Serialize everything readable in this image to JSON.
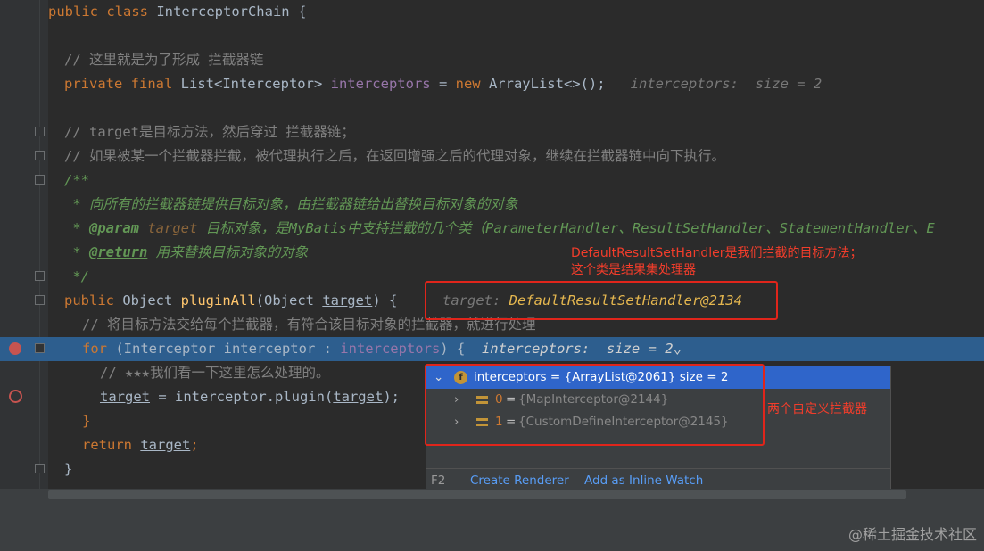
{
  "code": {
    "l1_kw": "public class ",
    "l1_rest": "InterceptorChain {",
    "l3_comment": "// 这里就是为了形成 拦截器链",
    "l4_kw": "private final ",
    "l4_type": "List<Interceptor> ",
    "l4_field": "interceptors",
    "l4_eq": " = ",
    "l4_new": "new ",
    "l4_rest": "ArrayList<>();",
    "l4_inlay": "interceptors:  size = 2",
    "l6_comment": "// target是目标方法，然后穿过 拦截器链；",
    "l7_comment": "// 如果被某一个拦截器拦截，被代理执行之后，在返回增强之后的代理对象，继续在拦截器链中向下执行。",
    "l8_doc": "/**",
    "l9_doc": " * 向所有的拦截器链提供目标对象，由拦截器链给出替换目标对象的对象",
    "l10_star": " * ",
    "l10_tag": "@param",
    "l10_name": " target",
    "l10_text": " 目标对象，是MyBatis中支持拦截的几个类（ParameterHandler、ResultSetHandler、StatementHandler、E",
    "l11_star": " * ",
    "l11_tag": "@return",
    "l11_text": " 用来替换目标对象的对象",
    "l12_doc": " */",
    "l13_kw": "public ",
    "l13_type": "Object ",
    "l13_fn": "pluginAll",
    "l13_paren": "(Object ",
    "l13_param": "target",
    "l13_end": ") {",
    "l13_inlay_label": "target:",
    "l13_inlay_value": "DefaultResultSetHandler@2134",
    "l14_comment": "// 将目标方法交给每个拦截器，有符合该目标对象的拦截器，就进行处理",
    "l15_kw": "for ",
    "l15_paren": "(Interceptor interceptor : ",
    "l15_field": "interceptors",
    "l15_end": ") {",
    "l15_inlay": "interceptors:  size = 2",
    "l16_comment": "// ★★★我们看一下这里怎么处理的。",
    "l17_param": "target",
    "l17_mid": " = interceptor.plugin(",
    "l17_param2": "target",
    "l17_end": ");",
    "l18_brace": "}",
    "l19_kw": "return ",
    "l19_param": "target",
    "l19_end": ";",
    "l20_brace": "}"
  },
  "annotations": {
    "target_note_1": "DefaultResultSetHandler是我们拦截的目标方法；",
    "target_note_2": "这个类是结果集处理器",
    "interceptors_note": "两个自定义拦截器"
  },
  "popup": {
    "root_label": "interceptors = {ArrayList@2061}  size = 2",
    "items": [
      {
        "index": "0",
        "value": "{MapInterceptor@2144}"
      },
      {
        "index": "1",
        "value": "{CustomDefineInterceptor@2145}"
      }
    ],
    "footer_key": "F2",
    "create_renderer": "Create Renderer",
    "add_inline_watch": "Add as Inline Watch"
  },
  "watermark": "@稀土掘金技术社区",
  "colors": {
    "editor_bg": "#2b2b2b",
    "highlight_line": "#2d5e8e",
    "annotation_red": "#f23d2b",
    "popup_selected": "#2f65ca"
  }
}
